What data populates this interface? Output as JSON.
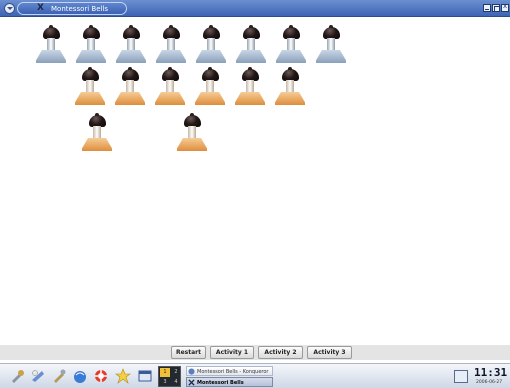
{
  "window": {
    "title": "Montessori Bells"
  },
  "bells": {
    "row1_color": "blue",
    "row2_color": "orange",
    "row1_count": 8,
    "row2_count": 6,
    "row3_count": 2
  },
  "buttons": {
    "restart": "Restart",
    "activity1": "Activity 1",
    "activity2": "Activity 2",
    "activity3": "Activity 3"
  },
  "taskbar": {
    "pager": [
      "1",
      "2",
      "3",
      "4"
    ],
    "tasks": [
      {
        "label": "Montessori Bells - Konqueror",
        "active": false
      },
      {
        "label": "Montessori Bells",
        "active": true
      }
    ],
    "clock": "11:31",
    "date": "2006-06-27"
  },
  "colors": {
    "titlebar": "#3d64b4",
    "bell_blue_base": "#8aa0ba",
    "bell_orange_base": "#dd8e3c"
  }
}
